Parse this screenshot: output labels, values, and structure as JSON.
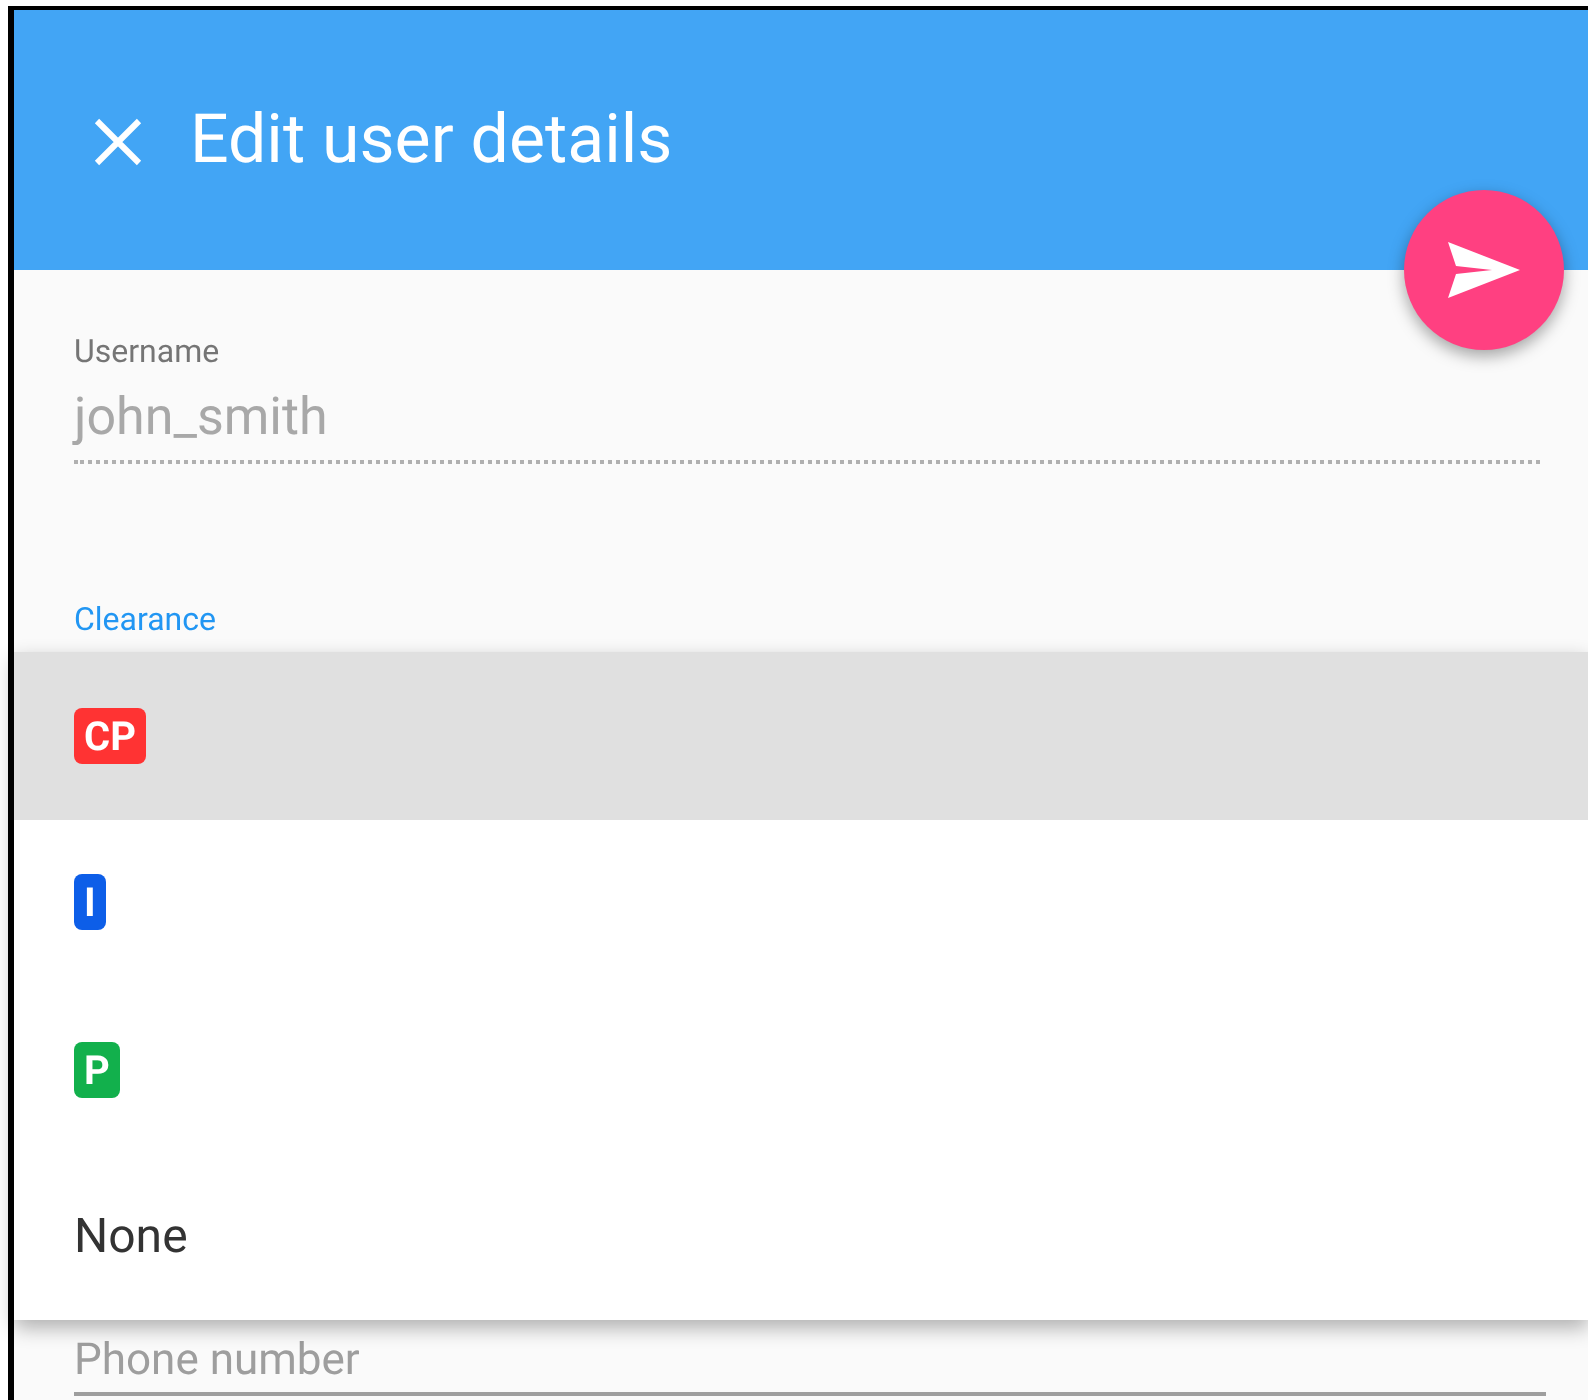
{
  "header": {
    "title": "Edit user details"
  },
  "fields": [
    {
      "label": "Username",
      "value": "john_smith",
      "disabled": true
    },
    {
      "label": "Clearance",
      "focused": true
    },
    {
      "label": "Phone number"
    }
  ],
  "menu": {
    "options": [
      {
        "kind": "badge",
        "label": "CP",
        "color": "#ff3333",
        "selected": true
      },
      {
        "kind": "badge",
        "label": "I",
        "color": "#0d5ee8",
        "selected": false
      },
      {
        "kind": "badge",
        "label": "P",
        "color": "#12b04c",
        "selected": false
      },
      {
        "kind": "text",
        "label": "None",
        "selected": false
      }
    ]
  }
}
